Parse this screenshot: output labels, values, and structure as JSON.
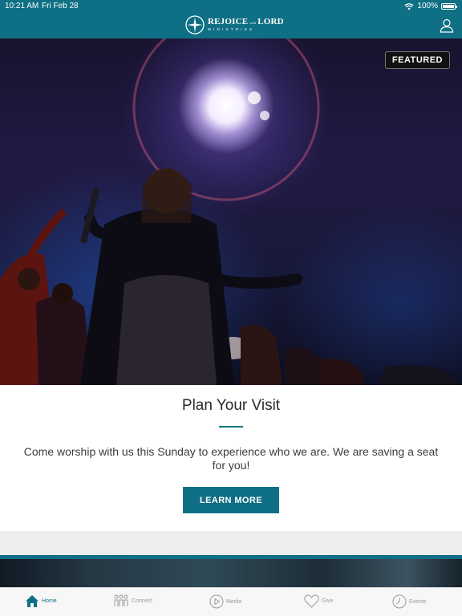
{
  "status_bar": {
    "time": "10:21 AM",
    "date": "Fri Feb 28",
    "battery": "100%",
    "battery_level": 1.0
  },
  "header": {
    "logo_line1_a": "REJOICE",
    "logo_line1_with": "with",
    "logo_line1_b": "LORD",
    "logo_line2": "MINISTRIES",
    "profile_icon": "person-outline-icon"
  },
  "hero": {
    "badge": "FEATURED"
  },
  "card": {
    "title": "Plan Your Visit",
    "description": "Come worship with us this Sunday to experience who we are. We are saving a seat for you!",
    "button": "LEARN MORE"
  },
  "tabbar": {
    "items": [
      {
        "label": "Home",
        "icon": "home-icon",
        "active": true
      },
      {
        "label": "Connect",
        "icon": "people-icon",
        "active": false
      },
      {
        "label": "Media",
        "icon": "play-circle-icon",
        "active": false
      },
      {
        "label": "Give",
        "icon": "heart-icon",
        "active": false
      },
      {
        "label": "Events",
        "icon": "clock-icon",
        "active": false
      }
    ]
  },
  "colors": {
    "brand": "#0f6f84",
    "tab_inactive": "#9a9a9a",
    "badge_bg": "#111111"
  }
}
